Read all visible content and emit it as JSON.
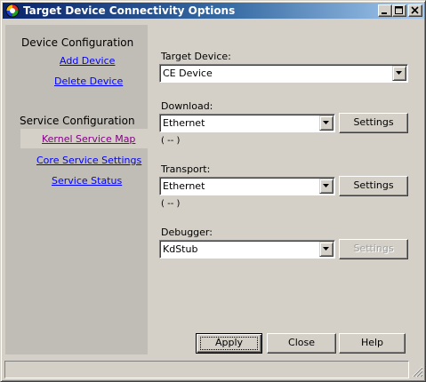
{
  "window": {
    "title": "Target Device Connectivity Options"
  },
  "sidebar": {
    "device_heading": "Device Configuration",
    "device_links": [
      "Add Device",
      "Delete Device"
    ],
    "service_heading": "Service Configuration",
    "service_links": [
      "Kernel Service Map",
      "Core Service Settings",
      "Service Status"
    ],
    "selected_link": "Kernel Service Map"
  },
  "target_device": {
    "label": "Target Device:",
    "value": "CE Device"
  },
  "download": {
    "label": "Download:",
    "value": "Ethernet",
    "settings_label": "Settings",
    "status": "( -- )"
  },
  "transport": {
    "label": "Transport:",
    "value": "Ethernet",
    "settings_label": "Settings",
    "status": "( -- )"
  },
  "debugger": {
    "label": "Debugger:",
    "value": "KdStub",
    "settings_label": "Settings",
    "settings_enabled": false
  },
  "buttons": {
    "apply": "Apply",
    "close": "Close",
    "help": "Help"
  }
}
